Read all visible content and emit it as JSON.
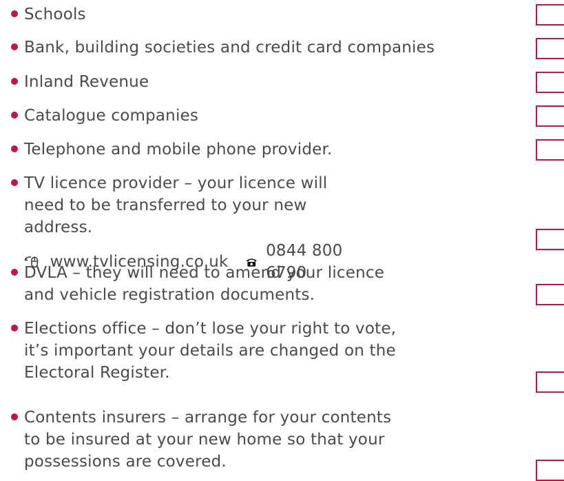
{
  "colors": {
    "accent": "#c0154a",
    "text": "#4a4a4a"
  },
  "items": [
    {
      "text": "Schools"
    },
    {
      "text": "Bank, building societies and credit card companies"
    },
    {
      "text": "Inland Revenue"
    },
    {
      "text": "Catalogue companies"
    },
    {
      "text": "Telephone and mobile phone provider."
    },
    {
      "text": "TV licence provider – your licence will need to be transferred to your new address.",
      "website": "www.tvlicensing.co.uk",
      "phone": "0844 800 6790",
      "website_icon": "mouse-icon",
      "phone_icon": "telephone-icon"
    },
    {
      "text": "DVLA – they will need to amend your licence and vehicle registration documents."
    },
    {
      "text": "Elections office – don’t lose your right to vote, it’s important your details are changed on the Electoral Register."
    },
    {
      "text": "Contents insurers – arrange for your contents to be insured at your new home so that your possessions are covered."
    }
  ]
}
